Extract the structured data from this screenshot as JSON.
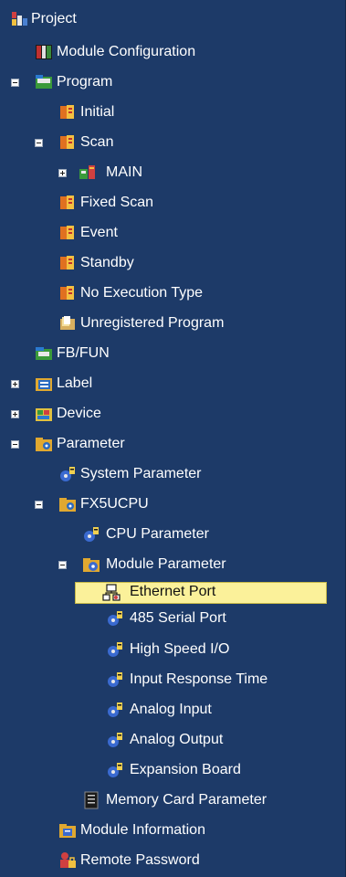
{
  "tree": {
    "items": [
      {
        "label": "Project",
        "icon": "project-icon"
      },
      {
        "label": "Module Configuration",
        "icon": "module-config-icon"
      },
      {
        "label": "Program",
        "icon": "program-folder-icon",
        "expander": "minus"
      },
      {
        "label": "Initial",
        "icon": "program-file-icon"
      },
      {
        "label": "Scan",
        "icon": "program-file-icon",
        "expander": "minus"
      },
      {
        "label": "MAIN",
        "icon": "main-program-icon",
        "expander": "plus"
      },
      {
        "label": "Fixed Scan",
        "icon": "program-file-icon"
      },
      {
        "label": "Event",
        "icon": "program-file-icon"
      },
      {
        "label": "Standby",
        "icon": "program-file-icon"
      },
      {
        "label": "No Execution Type",
        "icon": "program-file-icon"
      },
      {
        "label": "Unregistered Program",
        "icon": "unregistered-program-icon"
      },
      {
        "label": "FB/FUN",
        "icon": "fb-fun-icon"
      },
      {
        "label": "Label",
        "icon": "label-icon",
        "expander": "plus"
      },
      {
        "label": "Device",
        "icon": "device-icon",
        "expander": "plus"
      },
      {
        "label": "Parameter",
        "icon": "parameter-folder-icon",
        "expander": "minus"
      },
      {
        "label": "System Parameter",
        "icon": "parameter-gear-icon"
      },
      {
        "label": "FX5UCPU",
        "icon": "parameter-folder-icon",
        "expander": "minus"
      },
      {
        "label": "CPU Parameter",
        "icon": "parameter-gear-icon"
      },
      {
        "label": "Module Parameter",
        "icon": "module-parameter-icon",
        "expander": "minus"
      },
      {
        "label": "Ethernet Port",
        "icon": "ethernet-port-icon",
        "selected": true
      },
      {
        "label": "485 Serial Port",
        "icon": "parameter-gear-icon"
      },
      {
        "label": "High Speed I/O",
        "icon": "parameter-gear-icon"
      },
      {
        "label": "Input Response Time",
        "icon": "parameter-gear-icon"
      },
      {
        "label": "Analog Input",
        "icon": "parameter-gear-icon"
      },
      {
        "label": "Analog Output",
        "icon": "parameter-gear-icon"
      },
      {
        "label": "Expansion Board",
        "icon": "parameter-gear-icon"
      },
      {
        "label": "Memory Card Parameter",
        "icon": "memory-card-icon"
      },
      {
        "label": "Module Information",
        "icon": "module-info-icon"
      },
      {
        "label": "Remote Password",
        "icon": "remote-password-icon"
      }
    ]
  },
  "colors": {
    "background": "#1d3a68",
    "text": "#ffffff",
    "selection": "#fbf19a"
  }
}
